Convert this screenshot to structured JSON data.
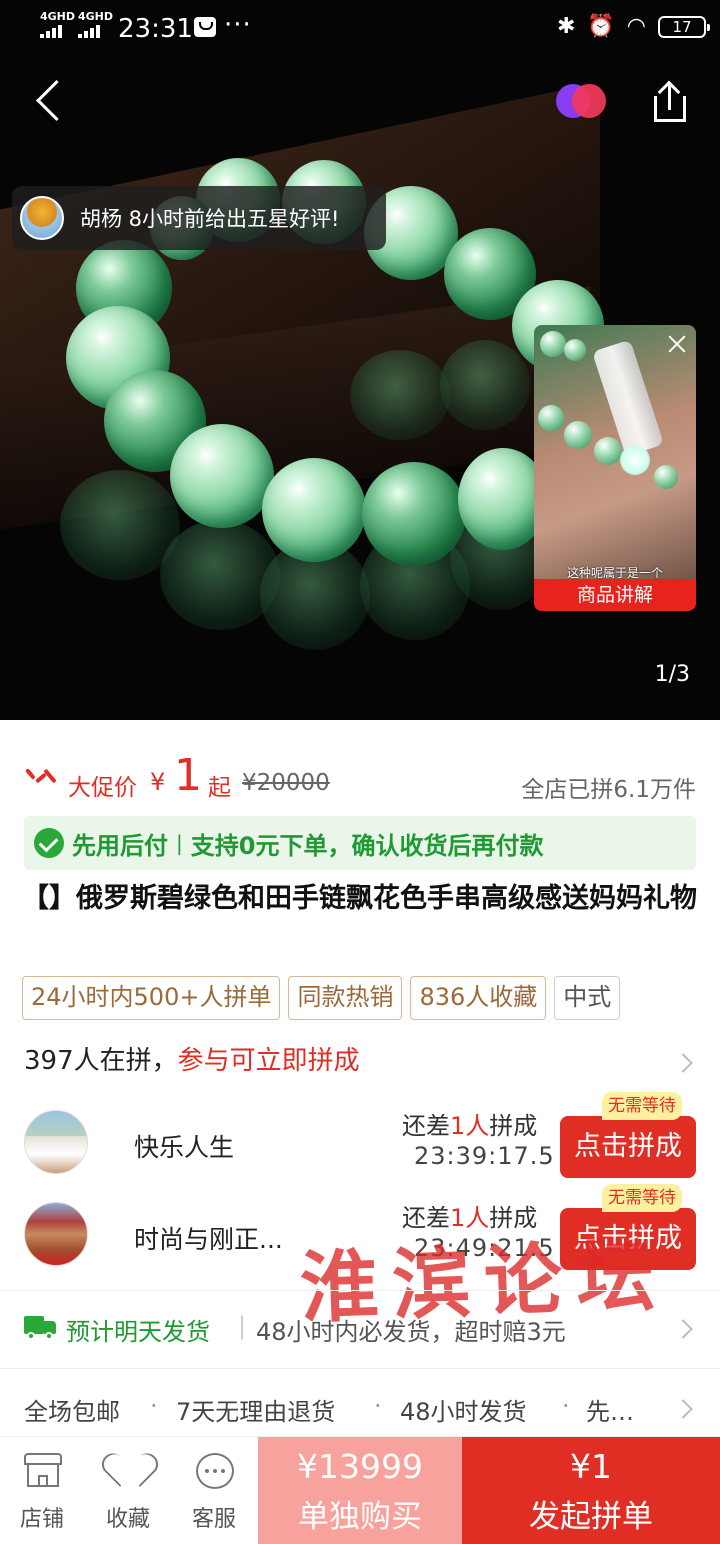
{
  "status_bar": {
    "signal_1": "4GHD",
    "signal_2": "4GHD",
    "time": "23:31",
    "more": "···",
    "battery": "17"
  },
  "hero": {
    "review_toast": "胡杨 8小时前给出五星好评!",
    "video_caption": "这种呢属于是一个",
    "video_label": "商品讲解",
    "pager": "1/3"
  },
  "price": {
    "promo_label": "大促价",
    "currency": "¥",
    "amount": "1",
    "suffix": "起",
    "original": "¥20000",
    "sold": "全店已拼6.1万件"
  },
  "pay_later": {
    "title": "先用后付",
    "separator": "|",
    "desc": "支持0元下单，确认收货后再付款"
  },
  "product_title": "【】俄罗斯碧绿色和田手链飘花色手串高级感送妈妈礼物",
  "tags": [
    "24小时内500+人拼单",
    "同款热销",
    "836人收藏",
    "中式"
  ],
  "group": {
    "count_text": "397人在拼，",
    "cta_text": "参与可立即拼成",
    "rows": [
      {
        "name": "快乐人生",
        "need_prefix": "还差",
        "need_count": "1人",
        "need_suffix": "拼成",
        "timer": "23:39:17.5",
        "badge": "无需等待",
        "button": "点击拼成"
      },
      {
        "name": "时尚与刚正...",
        "need_prefix": "还差",
        "need_count": "1人",
        "need_suffix": "拼成",
        "timer": "23:49:21.5",
        "badge": "无需等待",
        "button": "点击拼成"
      }
    ]
  },
  "watermark": "淮滨论坛",
  "shipping": {
    "highlight": "预计明天发货",
    "separator": "|",
    "detail": "48小时内必发货，超时赔3元"
  },
  "services": {
    "items": [
      "全场包邮",
      "7天无理由退货",
      "48小时发货",
      "先…"
    ],
    "dot": "·"
  },
  "bottom_bar": {
    "store": "店铺",
    "favorite": "收藏",
    "service": "客服",
    "solo_price": "¥13999",
    "solo_label": "单独购买",
    "group_price": "¥1",
    "group_label": "发起拼单"
  },
  "colors": {
    "accent_red": "#e02e24",
    "green": "#1f9a32",
    "tag_brown": "#9a6a3a"
  }
}
